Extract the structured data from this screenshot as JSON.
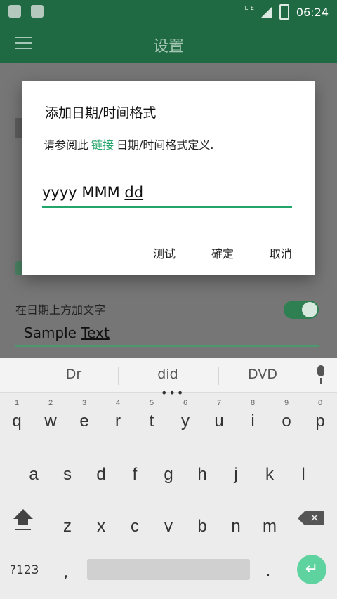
{
  "status": {
    "time": "06:24",
    "network": "LTE"
  },
  "app": {
    "title": "设置"
  },
  "settings": {
    "text_label": "在日期上方加文字",
    "sample_text_prefix": "Sample ",
    "sample_text_word": "Text",
    "toggle_on": true
  },
  "dialog": {
    "title": "添加日期/时间格式",
    "message_before": "请参阅此",
    "link_text": "链接",
    "message_after": "日期/时间格式定义.",
    "input_value_prefix": "yyyy MMM ",
    "input_value_word": "dd",
    "buttons": {
      "test": "测试",
      "ok": "確定",
      "cancel": "取消"
    }
  },
  "keyboard": {
    "suggestions": [
      "Dr",
      "did",
      "DVD"
    ],
    "row1": [
      {
        "key": "q",
        "hint": "1"
      },
      {
        "key": "w",
        "hint": "2"
      },
      {
        "key": "e",
        "hint": "3"
      },
      {
        "key": "r",
        "hint": "4"
      },
      {
        "key": "t",
        "hint": "5"
      },
      {
        "key": "y",
        "hint": "6"
      },
      {
        "key": "u",
        "hint": "7"
      },
      {
        "key": "i",
        "hint": "8"
      },
      {
        "key": "o",
        "hint": "9"
      },
      {
        "key": "p",
        "hint": "0"
      }
    ],
    "row2": [
      "a",
      "s",
      "d",
      "f",
      "g",
      "h",
      "j",
      "k",
      "l"
    ],
    "row3": [
      "z",
      "x",
      "c",
      "v",
      "b",
      "n",
      "m"
    ],
    "symbols_label": "?123",
    "comma": ",",
    "period": "."
  },
  "colors": {
    "accent": "#22a56a",
    "appbar": "#1f6a43"
  }
}
